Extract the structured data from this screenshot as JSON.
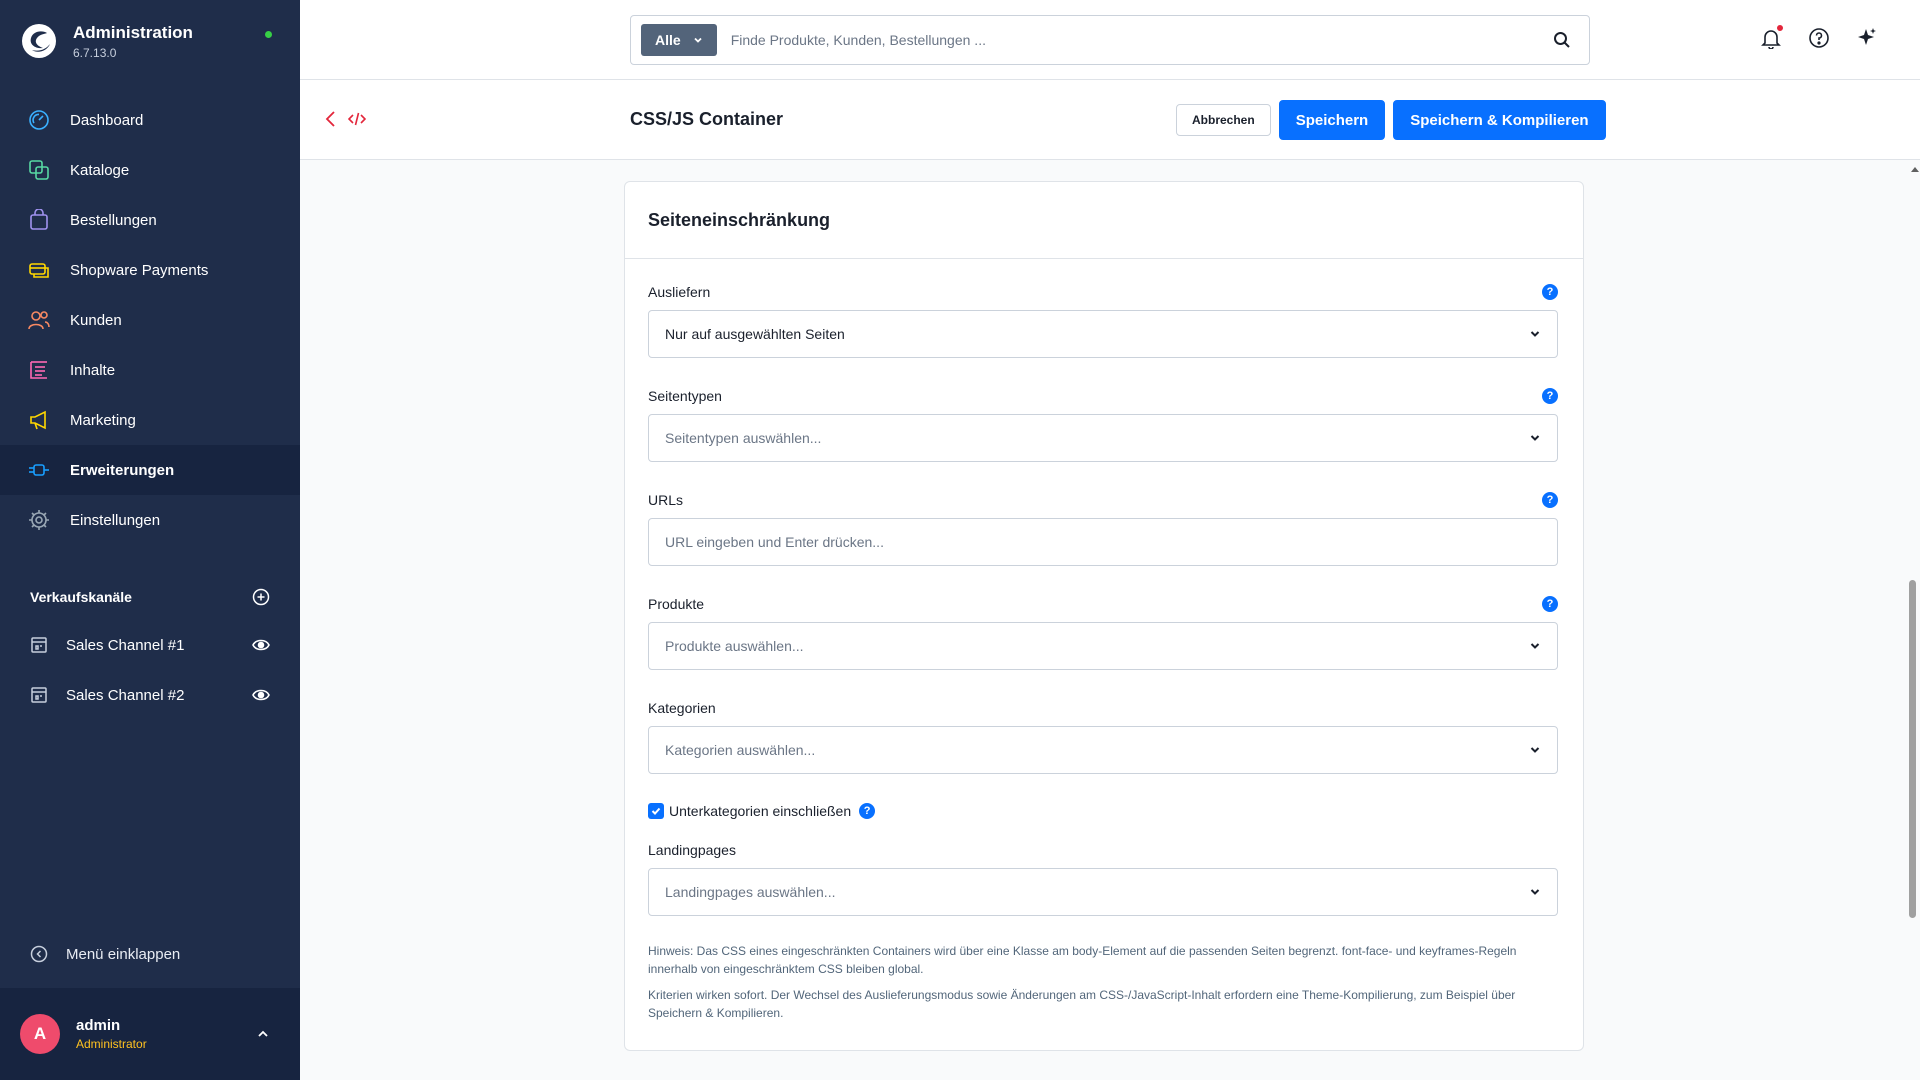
{
  "app": {
    "title": "Administration",
    "version": "6.7.13.0",
    "status_color": "#37d046"
  },
  "sidebar": {
    "items": [
      {
        "label": "Dashboard",
        "icon": "dashboard-gauge-icon",
        "color": "#3ab0ff",
        "active": false
      },
      {
        "label": "Kataloge",
        "icon": "catalog-icon",
        "color": "#57d9a3",
        "active": false
      },
      {
        "label": "Bestellungen",
        "icon": "orders-bag-icon",
        "color": "#a092f0",
        "active": false
      },
      {
        "label": "Shopware Payments",
        "icon": "payments-icon",
        "color": "#ffd700",
        "active": false
      },
      {
        "label": "Kunden",
        "icon": "customers-icon",
        "color": "#f88962",
        "active": false
      },
      {
        "label": "Inhalte",
        "icon": "content-icon",
        "color": "#ff68b4",
        "active": false
      },
      {
        "label": "Marketing",
        "icon": "marketing-megaphone-icon",
        "color": "#ffd700",
        "active": false
      },
      {
        "label": "Erweiterungen",
        "icon": "extensions-plug-icon",
        "color": "#189eff",
        "active": true
      },
      {
        "label": "Einstellungen",
        "icon": "settings-gear-icon",
        "color": "#9aa8b5",
        "active": false
      }
    ],
    "sales_channels_title": "Verkaufskanäle",
    "sales_channels": [
      {
        "label": "Sales Channel #1"
      },
      {
        "label": "Sales Channel #2"
      }
    ],
    "collapse_label": "Menü einklappen",
    "user": {
      "initial": "A",
      "name": "admin",
      "role": "Administrator"
    }
  },
  "search": {
    "type_label": "Alle",
    "placeholder": "Finde Produkte, Kunden, Bestellungen ..."
  },
  "smartbar": {
    "title": "CSS/JS Container",
    "cancel_label": "Abbrechen",
    "save_label": "Speichern",
    "save_compile_label": "Speichern & Kompilieren"
  },
  "card": {
    "title": "Seiteneinschränkung",
    "fields": {
      "ausliefern": {
        "label": "Ausliefern",
        "value": "Nur auf ausgewählten Seiten"
      },
      "seitentypen": {
        "label": "Seitentypen",
        "placeholder": "Seitentypen auswählen..."
      },
      "urls": {
        "label": "URLs",
        "placeholder": "URL eingeben und Enter drücken..."
      },
      "produkte": {
        "label": "Produkte",
        "placeholder": "Produkte auswählen..."
      },
      "kategorien": {
        "label": "Kategorien",
        "placeholder": "Kategorien auswählen..."
      },
      "unterkategorien": {
        "label": "Unterkategorien einschließen",
        "checked": true
      },
      "landingpages": {
        "label": "Landingpages",
        "placeholder": "Landingpages auswählen..."
      }
    },
    "help_glyph": "?",
    "hint_1": "Hinweis: Das CSS eines eingeschränkten Containers wird über eine Klasse am body-Element auf die passenden Seiten begrenzt. font-face- und keyframes-Regeln innerhalb von eingeschränktem CSS bleiben global.",
    "hint_2": "Kriterien wirken sofort. Der Wechsel des Auslieferungsmodus sowie Änderungen am CSS-/JavaScript-Inhalt erfordern eine Theme-Kompilierung, zum Beispiel über Speichern & Kompilieren."
  },
  "colors": {
    "primary": "#0870ff",
    "sidebar_bg": "#1f2d4a",
    "danger": "#e3263b"
  }
}
